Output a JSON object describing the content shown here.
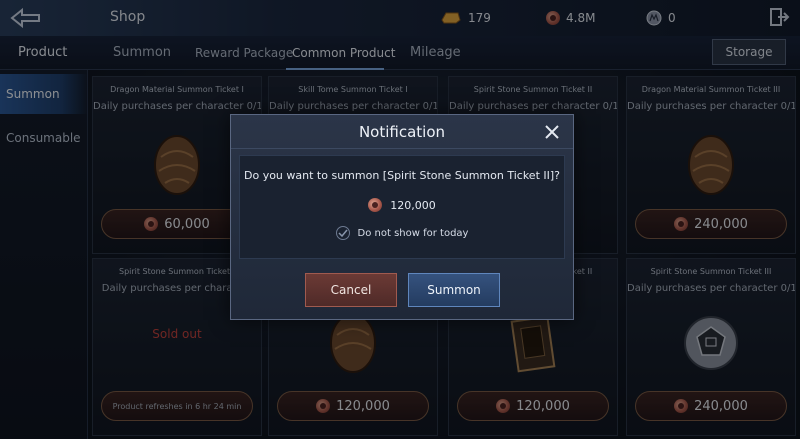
{
  "header": {
    "title": "Shop",
    "currencies": [
      {
        "icon": "gold-ingot-icon",
        "value": "179"
      },
      {
        "icon": "copper-coin-icon",
        "value": "4.8M"
      },
      {
        "icon": "silver-coin-icon",
        "value": "0"
      }
    ]
  },
  "tabs": {
    "product": "Product",
    "summon": "Summon",
    "reward_package": "Reward Package",
    "common_product": "Common Product",
    "mileage": "Mileage",
    "storage": "Storage"
  },
  "sidebar": {
    "items": [
      {
        "label": "Summon",
        "active": true
      },
      {
        "label": "Consumable",
        "active": false
      }
    ]
  },
  "cards": [
    {
      "name": "Dragon Material Summon Ticket I",
      "limit": "Daily purchases per character 0/1",
      "price": "60,000",
      "art": "bronze-egg-icon"
    },
    {
      "name": "Skill Tome Summon Ticket I",
      "limit": "Daily purchases per character 0/1",
      "price": "",
      "art": ""
    },
    {
      "name": "Spirit Stone Summon Ticket II",
      "limit": "Daily purchases per character 0/1",
      "price": "",
      "art": ""
    },
    {
      "name": "Dragon Material Summon Ticket III",
      "limit": "Daily purchases per character 0/1",
      "price": "240,000",
      "art": "bronze-egg-icon"
    },
    {
      "name": "Spirit Stone Summon Ticket I",
      "limit": "Daily purchases per character",
      "sold_out": "Sold out",
      "refresh": "Product refreshes in 6 hr 24 min"
    },
    {
      "name": "",
      "limit": "",
      "price": "120,000",
      "art": "bronze-egg-icon"
    },
    {
      "name": "Spirit Stone Summon Ticket II",
      "limit": "",
      "price": "120,000",
      "art": "dark-box-icon"
    },
    {
      "name": "Spirit Stone Summon Ticket III",
      "limit": "Daily purchases per character 0/1",
      "price": "240,000",
      "art": "silver-dice-icon"
    }
  ],
  "modal": {
    "title": "Notification",
    "question": "Do you want to summon [Spirit Stone Summon Ticket II]?",
    "cost": "120,000",
    "dont_show": "Do not show for today",
    "cancel": "Cancel",
    "summon": "Summon"
  },
  "colors": {
    "accent_blue": "#35527e",
    "cancel_red": "#6b3a35",
    "sold_out_red": "#c2423d"
  }
}
